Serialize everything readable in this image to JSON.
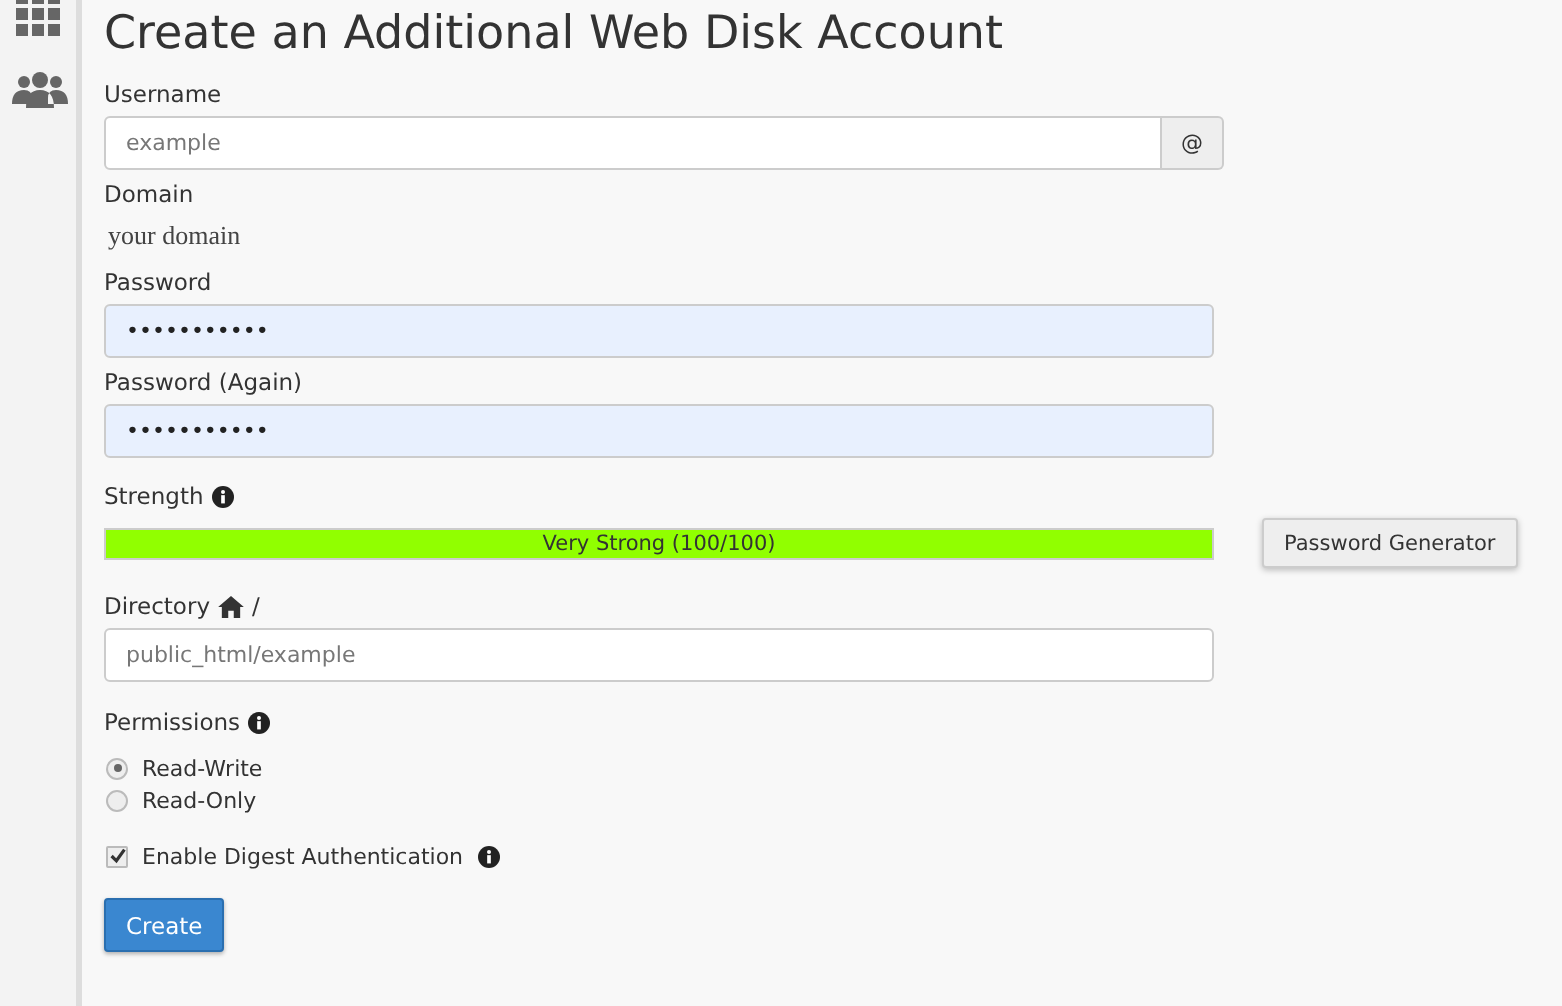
{
  "title": "Create an Additional Web Disk Account",
  "username": {
    "label": "Username",
    "placeholder": "example",
    "addon": "@"
  },
  "domain": {
    "label": "Domain",
    "value": "your domain"
  },
  "password": {
    "label": "Password",
    "value": "•••••••••••"
  },
  "password_again": {
    "label": "Password (Again)",
    "value": "•••••••••••"
  },
  "strength": {
    "label": "Strength",
    "level": 1,
    "reading": "Very Strong (100/100)",
    "generator_button": "Password Generator"
  },
  "directory": {
    "label": "Directory",
    "separator": "/",
    "placeholder": "public_html/example"
  },
  "permissions": {
    "label": "Permissions",
    "options": [
      {
        "label": "Read-Write",
        "selected": true
      },
      {
        "label": "Read-Only",
        "selected": false
      }
    ]
  },
  "digest": {
    "label": "Enable Digest Authentication",
    "checked": true
  },
  "submit": "Create"
}
